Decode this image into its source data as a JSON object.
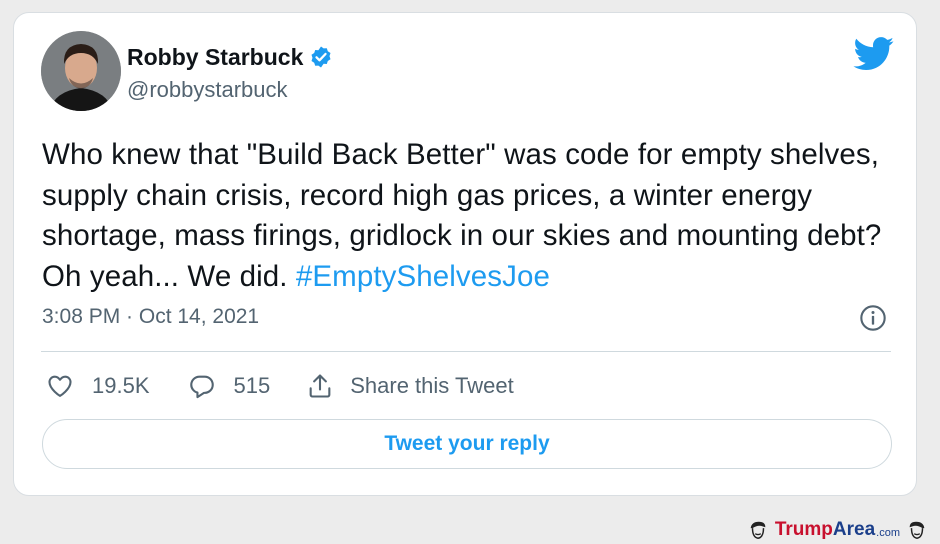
{
  "tweet": {
    "author_name": "Robby Starbuck",
    "handle": "@robbystarbuck",
    "text_main": "Who knew that \"Build Back Better\" was code for empty shelves, supply chain crisis, record high gas prices, a winter energy shortage, mass firings, gridlock in our skies and mounting debt? Oh yeah... We did. ",
    "hashtag": "#EmptyShelvesJoe",
    "timestamp": "3:08 PM · Oct 14, 2021",
    "likes": "19.5K",
    "replies": "515",
    "share_label": "Share this Tweet",
    "reply_button_label": "Tweet your reply"
  },
  "watermark": {
    "brand_part1": "Trump",
    "brand_part2": "Area",
    "suffix": ".com"
  },
  "colors": {
    "accent": "#1d9bf0",
    "text": "#0f1419",
    "muted": "#536471",
    "watermark_red": "#c8102e",
    "watermark_blue": "#1b3f8b"
  },
  "icons": [
    "verified-badge-icon",
    "twitter-bird-icon",
    "info-icon",
    "heart-icon",
    "reply-icon",
    "share-icon"
  ]
}
